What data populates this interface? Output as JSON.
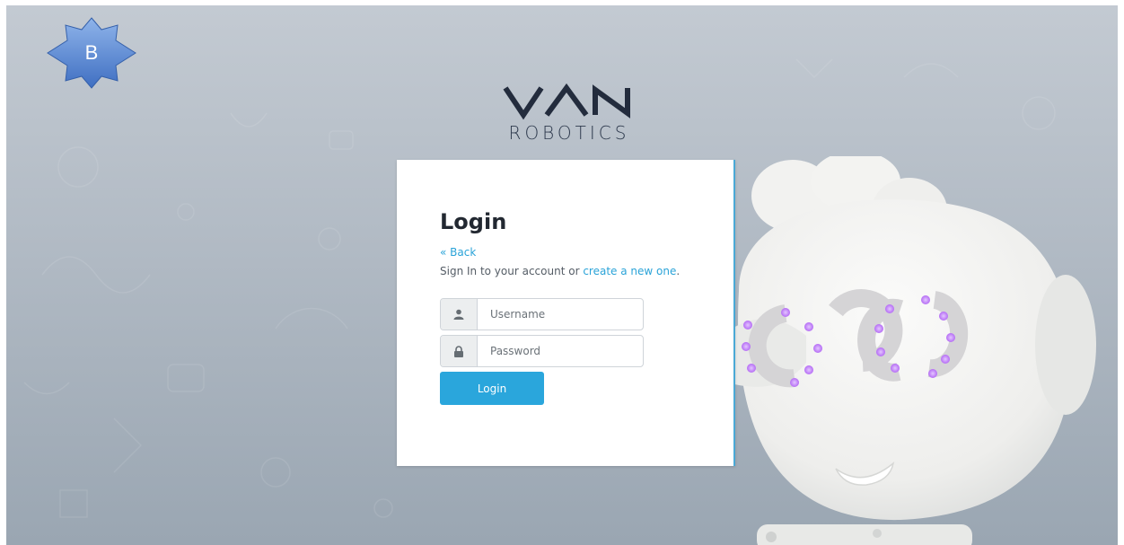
{
  "badge": {
    "letter": "B",
    "icon": "star-badge-icon"
  },
  "brand": {
    "name_top": "VAN",
    "name_bottom": "ROBOTICS"
  },
  "login": {
    "title": "Login",
    "back_label": "« Back",
    "signin_prefix": "Sign In to your account or ",
    "create_label": "create a new one",
    "signin_suffix": ".",
    "username": {
      "placeholder": "Username",
      "value": "",
      "icon": "user-icon"
    },
    "password": {
      "placeholder": "Password",
      "value": "",
      "icon": "lock-icon"
    },
    "button_label": "Login"
  },
  "colors": {
    "accent": "#2aa6dc",
    "link": "#2aa3d8",
    "background": "#b1bac4",
    "robot_eye_led": "#c07bff"
  }
}
